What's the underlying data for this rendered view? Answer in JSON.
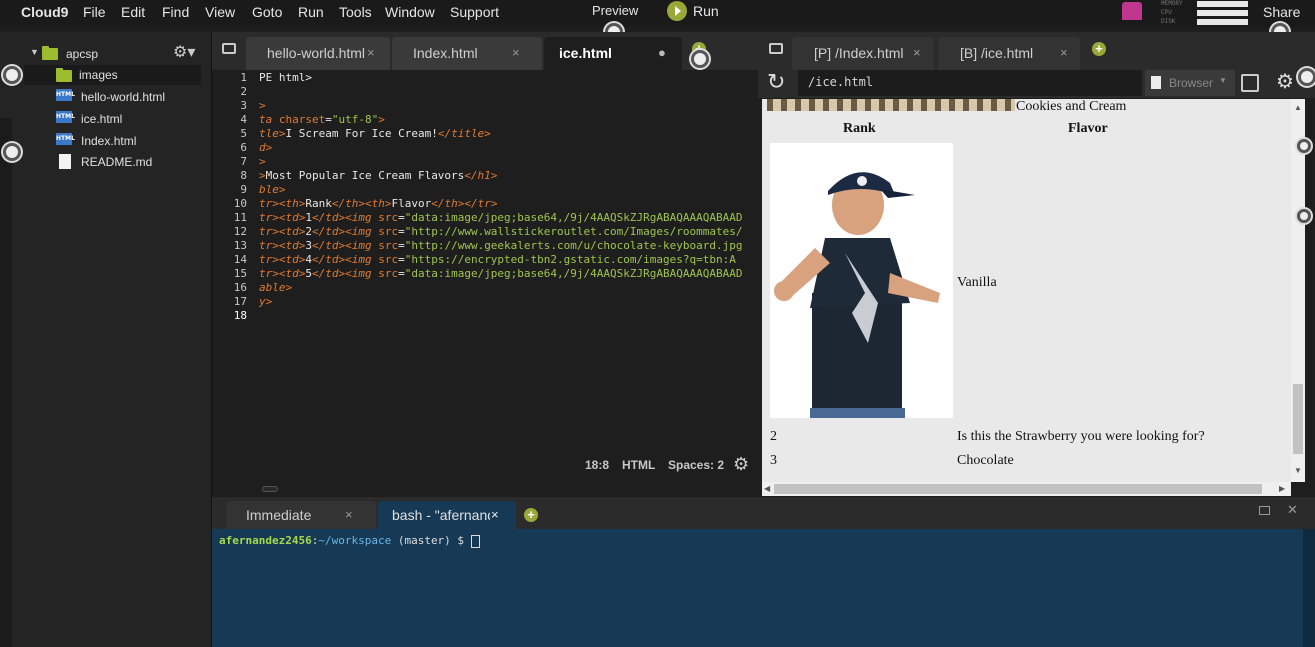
{
  "menubar": {
    "brand": "Cloud9",
    "items": [
      "File",
      "Edit",
      "Find",
      "View",
      "Goto",
      "Run",
      "Tools",
      "Window",
      "Support"
    ],
    "preview": "Preview",
    "run": "Run",
    "share": "Share",
    "meters": [
      "MEMORY",
      "CPU",
      "DISK"
    ]
  },
  "tree": {
    "root": "apcsp",
    "items": [
      {
        "label": "images",
        "icon": "folder-icon"
      },
      {
        "label": "hello-world.html",
        "icon": "html-file-icon"
      },
      {
        "label": "ice.html",
        "icon": "html-file-icon"
      },
      {
        "label": "Index.html",
        "icon": "html-file-icon"
      },
      {
        "label": "README.md",
        "icon": "document-icon"
      }
    ],
    "html_badge": "HTML"
  },
  "editor": {
    "tabs": [
      {
        "label": "hello-world.html",
        "close": "×"
      },
      {
        "label": "Index.html",
        "close": "×"
      },
      {
        "label": "ice.html",
        "close": "●"
      }
    ],
    "line_numbers": [
      "1",
      "2",
      "3",
      "4",
      "5",
      "6",
      "7",
      "8",
      "9",
      "10",
      "11",
      "12",
      "13",
      "14",
      "15",
      "16",
      "17",
      "18"
    ],
    "lines": [
      [
        {
          "t": "PE html>",
          "c": "plain"
        }
      ],
      [],
      [
        {
          "t": ">",
          "c": "tag"
        }
      ],
      [
        {
          "t": "ta ",
          "c": "tag"
        },
        {
          "t": "charset",
          "c": "attr"
        },
        {
          "t": "=",
          "c": "plain"
        },
        {
          "t": "\"utf-8\"",
          "c": "str"
        },
        {
          "t": ">",
          "c": "tag"
        }
      ],
      [
        {
          "t": "tle>",
          "c": "tag"
        },
        {
          "t": "I Scream For Ice Cream!",
          "c": "plain"
        },
        {
          "t": "</title>",
          "c": "tag"
        }
      ],
      [
        {
          "t": "d>",
          "c": "tag"
        }
      ],
      [
        {
          "t": ">",
          "c": "tag"
        }
      ],
      [
        {
          "t": ">",
          "c": "tag"
        },
        {
          "t": "Most Popular Ice Cream Flavors",
          "c": "plain"
        },
        {
          "t": "</h1>",
          "c": "tag"
        }
      ],
      [
        {
          "t": "ble>",
          "c": "tag"
        }
      ],
      [
        {
          "t": "tr><th>",
          "c": "tag"
        },
        {
          "t": "Rank",
          "c": "plain"
        },
        {
          "t": "</th><th>",
          "c": "tag"
        },
        {
          "t": "Flavor",
          "c": "plain"
        },
        {
          "t": "</th></tr>",
          "c": "tag"
        }
      ],
      [
        {
          "t": "tr><td>",
          "c": "tag"
        },
        {
          "t": "1",
          "c": "plain"
        },
        {
          "t": "</td><img ",
          "c": "tag"
        },
        {
          "t": "src",
          "c": "attr"
        },
        {
          "t": "=",
          "c": "plain"
        },
        {
          "t": "\"data:image/jpeg;base64,/9j/4AAQSkZJRgABAQAAAQABAAD",
          "c": "str"
        }
      ],
      [
        {
          "t": "tr><td>",
          "c": "tag"
        },
        {
          "t": "2",
          "c": "plain"
        },
        {
          "t": "</td><img ",
          "c": "tag"
        },
        {
          "t": "src",
          "c": "attr"
        },
        {
          "t": "=",
          "c": "plain"
        },
        {
          "t": "\"http://www.wallstickeroutlet.com/Images/roommates/",
          "c": "str"
        }
      ],
      [
        {
          "t": "tr><td>",
          "c": "tag"
        },
        {
          "t": "3",
          "c": "plain"
        },
        {
          "t": "</td><img ",
          "c": "tag"
        },
        {
          "t": "src",
          "c": "attr"
        },
        {
          "t": "=",
          "c": "plain"
        },
        {
          "t": "\"http://www.geekalerts.com/u/chocolate-keyboard.jpg",
          "c": "str"
        }
      ],
      [
        {
          "t": "tr><td>",
          "c": "tag"
        },
        {
          "t": "4",
          "c": "plain"
        },
        {
          "t": "</td><img ",
          "c": "tag"
        },
        {
          "t": "src",
          "c": "attr"
        },
        {
          "t": "=",
          "c": "plain"
        },
        {
          "t": "\"https://encrypted-tbn2.gstatic.com/images?q=tbn:A",
          "c": "str"
        }
      ],
      [
        {
          "t": "tr><td>",
          "c": "tag"
        },
        {
          "t": "5",
          "c": "plain"
        },
        {
          "t": "</td><img ",
          "c": "tag"
        },
        {
          "t": "src",
          "c": "attr"
        },
        {
          "t": "=",
          "c": "plain"
        },
        {
          "t": "\"data:image/jpeg;base64,/9j/4AAQSkZJRgABAQAAAQABAAD",
          "c": "str"
        }
      ],
      [
        {
          "t": "able>",
          "c": "tag"
        }
      ],
      [
        {
          "t": "y>",
          "c": "tag"
        }
      ],
      []
    ],
    "status": {
      "position": "18:8",
      "mode": "HTML",
      "spaces": "Spaces: 2"
    }
  },
  "preview": {
    "tabs": [
      {
        "label": "[P] /Index.html",
        "close": "×"
      },
      {
        "label": "[B] /ice.html",
        "close": "×"
      }
    ],
    "url": "/ice.html",
    "browser_label": "Browser",
    "page": {
      "top_caption": "Cookies and Cream",
      "headers": [
        "Rank",
        "Flavor"
      ],
      "rows": [
        {
          "rank": "",
          "flavor": "Vanilla"
        },
        {
          "rank": "2",
          "flavor": "Is this the Strawberry you were looking for?"
        },
        {
          "rank": "3",
          "flavor": "Chocolate"
        }
      ]
    }
  },
  "terminal": {
    "tabs": [
      {
        "label": "Immediate",
        "close": "×"
      },
      {
        "label": "bash - \"afernande",
        "close": "×"
      }
    ],
    "prompt_user": "afernandez2456",
    "prompt_sep": ":",
    "prompt_path": "~/workspace",
    "prompt_branch": " (master) $ "
  },
  "colors": {
    "tag": "#e07a2f",
    "attr": "#e07a2f",
    "str": "#9ec54a",
    "plain": "#e8e8e8",
    "accent": "#9aa83a",
    "term_bg": "#163a55",
    "prompt_user": "#a6d94c",
    "prompt_path": "#6cb6e6"
  }
}
